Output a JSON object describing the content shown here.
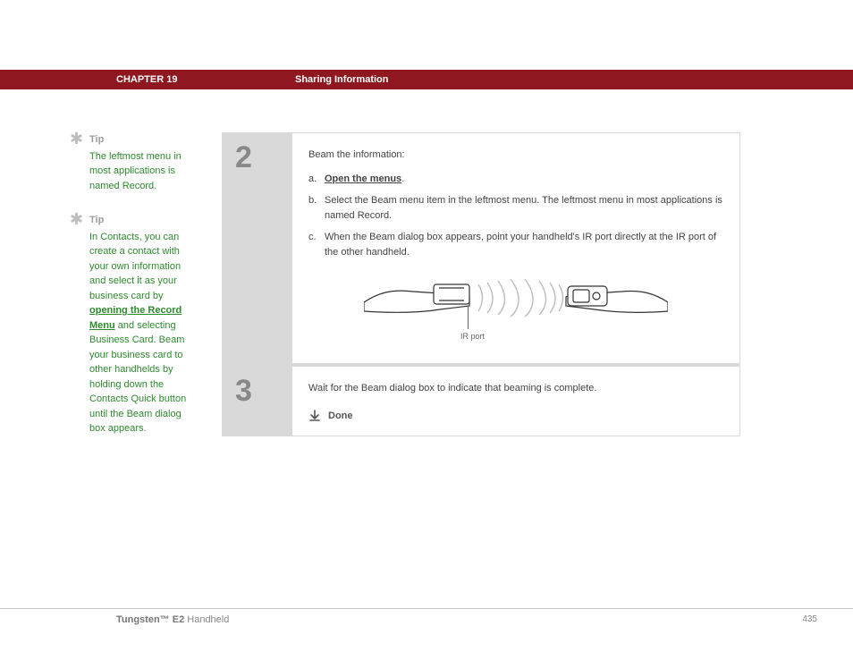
{
  "header": {
    "chapter": "CHAPTER 19",
    "section": "Sharing Information"
  },
  "tips": [
    {
      "label": "Tip",
      "body_pre": "The leftmost menu in most applications is named Record.",
      "link": "",
      "body_post": ""
    },
    {
      "label": "Tip",
      "body_pre": "In Contacts, you can create a contact with your own information and select it as your business card by ",
      "link": "opening the Record Menu",
      "body_post": " and selecting Business Card. Beam your business card to other handhelds by holding down the Contacts Quick button until the Beam dialog box appears."
    }
  ],
  "steps": [
    {
      "num": "2",
      "intro": "Beam the information:",
      "subs": [
        {
          "lett": "a.",
          "pre": "",
          "link": "Open the menus",
          "post": "."
        },
        {
          "lett": "b.",
          "pre": "Select the Beam menu item in the leftmost menu. The leftmost menu in most applications is named Record.",
          "link": "",
          "post": ""
        },
        {
          "lett": "c.",
          "pre": "When the Beam dialog box appears, point your handheld's IR port directly at the IR port of the other handheld.",
          "link": "",
          "post": ""
        }
      ],
      "ir_label": "IR port"
    },
    {
      "num": "3",
      "intro": "Wait for the Beam dialog box to indicate that beaming is complete.",
      "done": "Done"
    }
  ],
  "footer": {
    "product_bold": "Tungsten™ E2",
    "product_rest": " Handheld",
    "page": "435"
  }
}
